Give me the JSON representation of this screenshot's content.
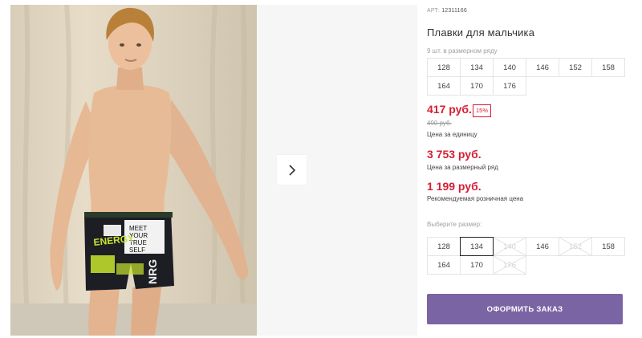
{
  "product": {
    "article_label": "АРТ:",
    "article_value": "12311166",
    "title": "Плавки для мальчика",
    "pack_note": "9 шт. в размерном ряду",
    "pack_sizes": [
      "128",
      "134",
      "140",
      "146",
      "152",
      "158",
      "164",
      "170",
      "176"
    ]
  },
  "pricing": {
    "unit_price": "417 руб.",
    "discount_badge": "15%",
    "old_price": "490 руб.",
    "unit_caption": "Цена за единицу",
    "pack_price": "3 753 руб.",
    "pack_caption": "Цена за размерный ряд",
    "retail_price": "1 199 руб.",
    "retail_caption": "Рекомендуемая розничная цена"
  },
  "size_picker": {
    "label": "Выберите размер:",
    "options": [
      {
        "size": "128",
        "state": "available"
      },
      {
        "size": "134",
        "state": "selected"
      },
      {
        "size": "140",
        "state": "unavailable"
      },
      {
        "size": "146",
        "state": "available"
      },
      {
        "size": "152",
        "state": "unavailable"
      },
      {
        "size": "158",
        "state": "available"
      },
      {
        "size": "164",
        "state": "available"
      },
      {
        "size": "170",
        "state": "available"
      },
      {
        "size": "176",
        "state": "unavailable"
      }
    ]
  },
  "actions": {
    "order_label": "ОФОРМИТЬ ЗАКАЗ"
  },
  "icons": {
    "next": "chevron-right-icon"
  },
  "print_text": {
    "line1": "MEET",
    "line2": "YOUR",
    "line3": "TRUE",
    "line4": "SELF",
    "energy": "ENERGY",
    "side": "NRG"
  },
  "colors": {
    "price_red": "#d61e34",
    "button_purple": "#7b64a4",
    "cell_border": "#e4e4e4",
    "print_lime": "#c8e62e"
  }
}
